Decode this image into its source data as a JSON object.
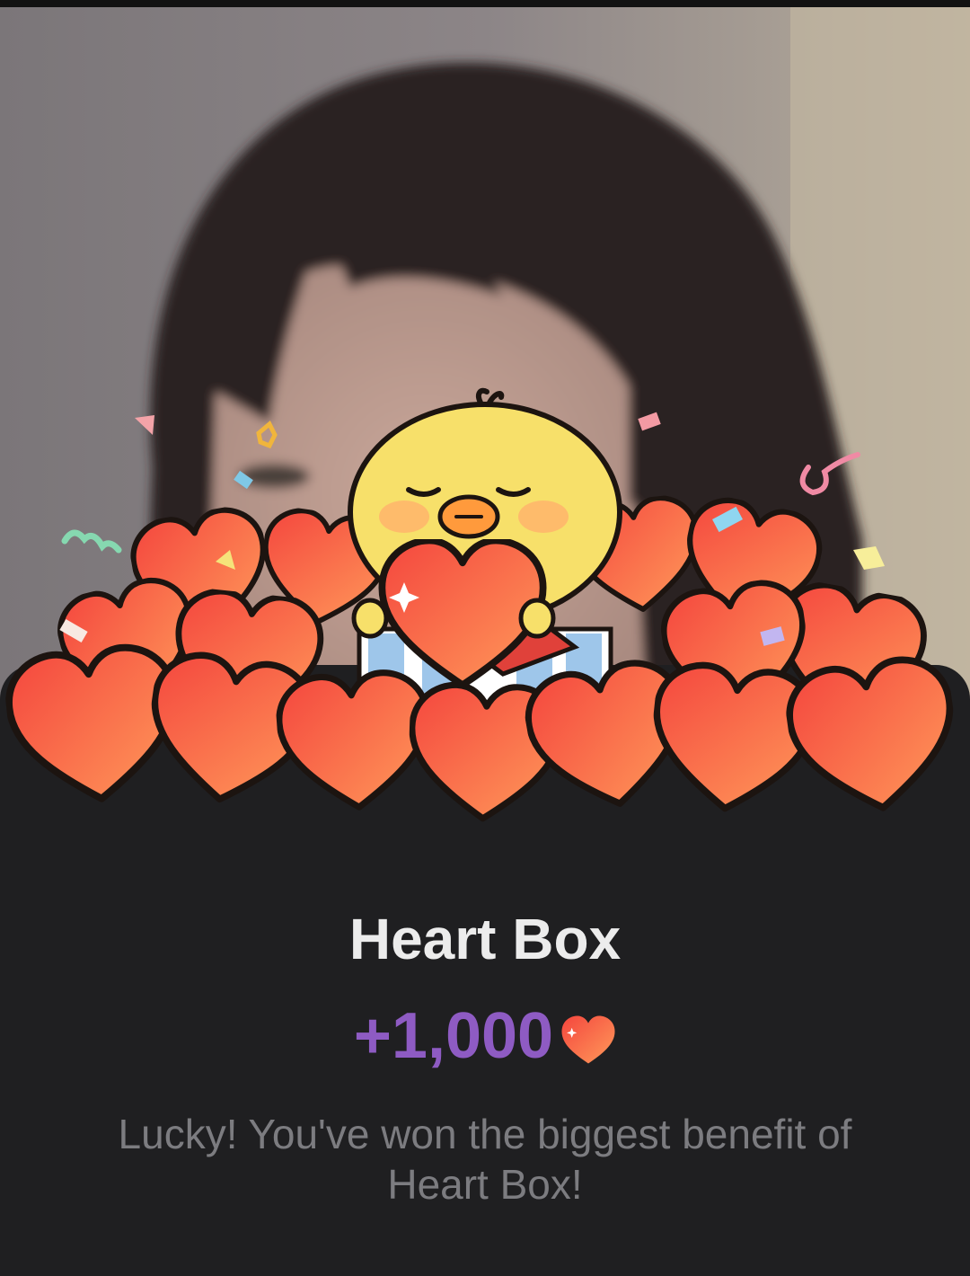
{
  "reward": {
    "title": "Heart Box",
    "amount": "+1,000",
    "amount_icon": "heart-icon",
    "message": "Lucky! You've won the biggest benefit of Heart Box!"
  },
  "colors": {
    "background": "#1f1f21",
    "title": "#ececec",
    "amount": "#8e5bc3",
    "message": "#7c7c80",
    "heart": "#f6533f"
  },
  "illustration": {
    "character": "yellow-chick-hugging-heart",
    "decoration": "heart-pile-confetti"
  }
}
